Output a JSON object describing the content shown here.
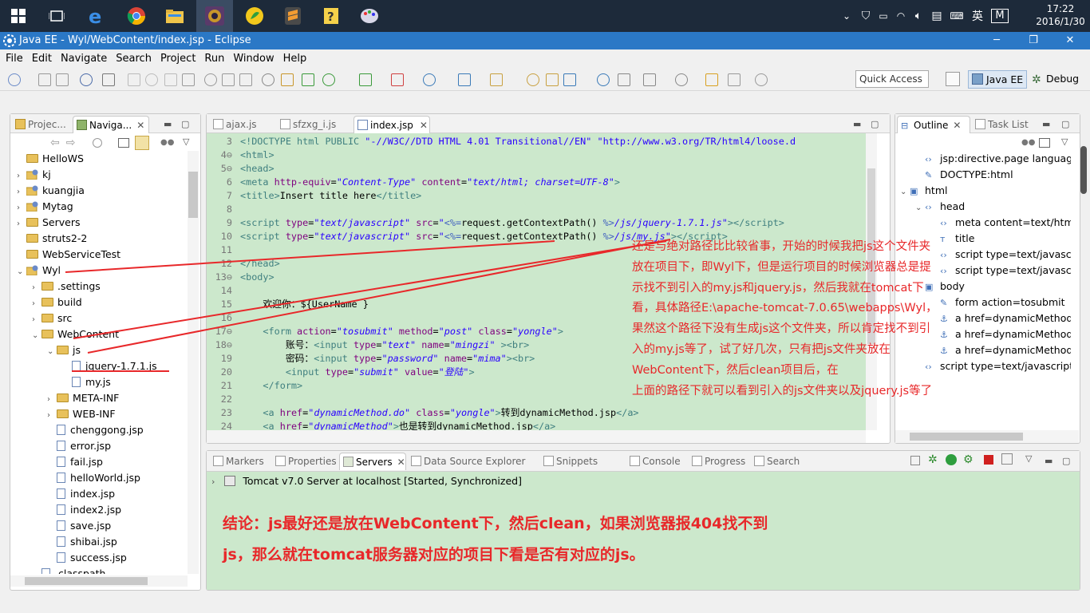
{
  "taskbar": {
    "time": "17:22",
    "date": "2016/1/30",
    "ime1": "英",
    "ime2": "M"
  },
  "window": {
    "title": "Java EE - Wyl/WebContent/index.jsp - Eclipse"
  },
  "menu": [
    "File",
    "Edit",
    "Navigate",
    "Search",
    "Project",
    "Run",
    "Window",
    "Help"
  ],
  "toolbar": {
    "quick_access": "Quick Access",
    "persp_javaee": "Java EE",
    "persp_debug": "Debug"
  },
  "left": {
    "tabs": [
      "Projec...",
      "Naviga..."
    ],
    "tree": [
      {
        "label": "HelloWS",
        "depth": 0,
        "arrow": "",
        "icon": "folder"
      },
      {
        "label": "kj",
        "depth": 0,
        "arrow": "›",
        "icon": "project"
      },
      {
        "label": "kuangjia",
        "depth": 0,
        "arrow": "›",
        "icon": "project"
      },
      {
        "label": "Mytag",
        "depth": 0,
        "arrow": "›",
        "icon": "project"
      },
      {
        "label": "Servers",
        "depth": 0,
        "arrow": "›",
        "icon": "folder"
      },
      {
        "label": "struts2-2",
        "depth": 0,
        "arrow": "",
        "icon": "folder"
      },
      {
        "label": "WebServiceTest",
        "depth": 0,
        "arrow": "",
        "icon": "folder"
      },
      {
        "label": "Wyl",
        "depth": 0,
        "arrow": "⌄",
        "icon": "project"
      },
      {
        "label": ".settings",
        "depth": 1,
        "arrow": "›",
        "icon": "folder"
      },
      {
        "label": "build",
        "depth": 1,
        "arrow": "›",
        "icon": "folder"
      },
      {
        "label": "src",
        "depth": 1,
        "arrow": "›",
        "icon": "folder"
      },
      {
        "label": "WebContent",
        "depth": 1,
        "arrow": "⌄",
        "icon": "folder"
      },
      {
        "label": "js",
        "depth": 2,
        "arrow": "⌄",
        "icon": "folder"
      },
      {
        "label": "jquery-1.7.1.js",
        "depth": 3,
        "arrow": "",
        "icon": "file"
      },
      {
        "label": "my.js",
        "depth": 3,
        "arrow": "",
        "icon": "file"
      },
      {
        "label": "META-INF",
        "depth": 2,
        "arrow": "›",
        "icon": "folder"
      },
      {
        "label": "WEB-INF",
        "depth": 2,
        "arrow": "›",
        "icon": "folder"
      },
      {
        "label": "chenggong.jsp",
        "depth": 2,
        "arrow": "",
        "icon": "file"
      },
      {
        "label": "error.jsp",
        "depth": 2,
        "arrow": "",
        "icon": "file"
      },
      {
        "label": "fail.jsp",
        "depth": 2,
        "arrow": "",
        "icon": "file"
      },
      {
        "label": "helloWorld.jsp",
        "depth": 2,
        "arrow": "",
        "icon": "file"
      },
      {
        "label": "index.jsp",
        "depth": 2,
        "arrow": "",
        "icon": "file"
      },
      {
        "label": "index2.jsp",
        "depth": 2,
        "arrow": "",
        "icon": "file"
      },
      {
        "label": "save.jsp",
        "depth": 2,
        "arrow": "",
        "icon": "file"
      },
      {
        "label": "shibai.jsp",
        "depth": 2,
        "arrow": "",
        "icon": "file"
      },
      {
        "label": "success.jsp",
        "depth": 2,
        "arrow": "",
        "icon": "file"
      },
      {
        "label": ".classpath",
        "depth": 1,
        "arrow": "",
        "icon": "file"
      }
    ]
  },
  "editor": {
    "tabs": [
      "ajax.js",
      "sfzxg_i.js",
      "index.jsp"
    ],
    "lines": [
      {
        "n": "3",
        "html": "<span class='tg'>&lt;!DOCTYPE html PUBLIC </span><span class='st' style='font-style:normal'>\"-//W3C//DTD HTML 4.01 Transitional//EN\" \"http://www.w3.org/TR/html4/loose.d</span>"
      },
      {
        "n": "4⊖",
        "html": "<span class='tg'>&lt;html&gt;</span>"
      },
      {
        "n": "5⊖",
        "html": "<span class='tg'>&lt;head&gt;</span>"
      },
      {
        "n": "6",
        "html": "<span class='tg'>&lt;meta </span><span class='at'>http-equiv</span>=<span class='st'>\"Content-Type\"</span> <span class='at'>content</span>=<span class='st'>\"text/html; charset=UTF-8\"</span><span class='tg'>&gt;</span>"
      },
      {
        "n": "7",
        "html": "<span class='tg'>&lt;title&gt;</span>Insert title here<span class='tg'>&lt;/title&gt;</span>"
      },
      {
        "n": "8",
        "html": ""
      },
      {
        "n": "9",
        "html": "<span class='tg'>&lt;script </span><span class='at'>type</span>=<span class='st'>\"text/javascript\"</span> <span class='at'>src</span>=<span class='st'>\"</span><span class='dt'>&lt;%=</span>request.getContextPath() <span class='dt'>%&gt;</span><span class='st'>/js/jquery-1.7.1.js\"</span><span class='tg'>&gt;&lt;/script&gt;</span>"
      },
      {
        "n": "10",
        "html": "<span class='tg'>&lt;script </span><span class='at'>type</span>=<span class='st'>\"text/javascript\"</span> <span class='at'>src</span>=<span class='st'>\"</span><span class='dt'>&lt;%=</span>request.getContextPath() <span class='dt'>%&gt;</span><span class='st'>/js/my.js\"</span><span class='tg'>&gt;&lt;/script&gt;</span>"
      },
      {
        "n": "11",
        "html": ""
      },
      {
        "n": "12",
        "html": "<span class='tg'>&lt;/head&gt;</span>"
      },
      {
        "n": "13⊖",
        "html": "<span class='tg'>&lt;body&gt;</span>"
      },
      {
        "n": "14",
        "html": ""
      },
      {
        "n": "15",
        "html": "    欢迎你：${UserName }"
      },
      {
        "n": "16",
        "html": ""
      },
      {
        "n": "17⊖",
        "html": "    <span class='tg'>&lt;form </span><span class='at'>action</span>=<span class='st'>\"tosubmit\"</span> <span class='at'>method</span>=<span class='st'>\"post\"</span> <span class='at'>class</span>=<span class='st'>\"yongle\"</span><span class='tg'>&gt;</span>"
      },
      {
        "n": "18⊖",
        "html": "        账号：<span class='tg'>&lt;input </span><span class='at'>type</span>=<span class='st'>\"text\"</span> <span class='at'>name</span>=<span class='st'>\"mingzi\"</span> <span class='tg'>&gt;&lt;br&gt;</span>"
      },
      {
        "n": "19",
        "html": "        密码：<span class='tg'>&lt;input </span><span class='at'>type</span>=<span class='st'>\"password\"</span> <span class='at'>name</span>=<span class='st'>\"mima\"</span><span class='tg'>&gt;&lt;br&gt;</span>"
      },
      {
        "n": "20",
        "html": "        <span class='tg'>&lt;input </span><span class='at'>type</span>=<span class='st'>\"submit\"</span> <span class='at'>value</span>=<span class='st'>\"登陆\"</span><span class='tg'>&gt;</span>"
      },
      {
        "n": "21",
        "html": "    <span class='tg'>&lt;/form&gt;</span>"
      },
      {
        "n": "22",
        "html": ""
      },
      {
        "n": "23",
        "html": "    <span class='tg'>&lt;a </span><span class='at'>href</span>=<span class='st'>\"dynamicMethod.do\"</span> <span class='at'>class</span>=<span class='st'>\"yongle\"</span><span class='tg'>&gt;</span>转到dynamicMethod.jsp<span class='tg'>&lt;/a&gt;</span>"
      },
      {
        "n": "24",
        "html": "    <span class='tg'>&lt;a </span><span class='at'>href</span>=<span class='st'>\"dynamicMethod\"</span><span class='tg'>&gt;</span>也是转到dynamicMethod.jsp<span class='tg'>&lt;/a&gt;</span>"
      }
    ]
  },
  "outline": {
    "tabs": [
      "Outline",
      "Task List"
    ],
    "rows": [
      {
        "label": "jsp:directive.page language=jav",
        "depth": 1,
        "icon": "<>",
        "arrow": ""
      },
      {
        "label": "DOCTYPE:html",
        "depth": 1,
        "icon": "doc",
        "arrow": ""
      },
      {
        "label": "html",
        "depth": 0,
        "icon": "box",
        "arrow": "⌄"
      },
      {
        "label": "head",
        "depth": 1,
        "icon": "<>",
        "arrow": "⌄"
      },
      {
        "label": "meta content=text/html; c",
        "depth": 2,
        "icon": "<>",
        "arrow": ""
      },
      {
        "label": "title",
        "depth": 2,
        "icon": "tt",
        "arrow": ""
      },
      {
        "label": "script type=text/javascrip",
        "depth": 2,
        "icon": "<>",
        "arrow": ""
      },
      {
        "label": "script type=text/javascrip",
        "depth": 2,
        "icon": "<>",
        "arrow": ""
      },
      {
        "label": "body",
        "depth": 1,
        "icon": "box",
        "arrow": ""
      },
      {
        "label": "form action=tosubmit",
        "depth": 2,
        "icon": "doc",
        "arrow": ""
      },
      {
        "label": "a href=dynamicMethod.d",
        "depth": 2,
        "icon": "anchor",
        "arrow": ""
      },
      {
        "label": "a href=dynamicMethod",
        "depth": 2,
        "icon": "anchor",
        "arrow": ""
      },
      {
        "label": "a href=dynamicMethod.a",
        "depth": 2,
        "icon": "anchor",
        "arrow": ""
      },
      {
        "label": "script type=text/javascript",
        "depth": 1,
        "icon": "<>",
        "arrow": ""
      }
    ]
  },
  "bottom": {
    "tabs": [
      "Markers",
      "Properties",
      "Servers",
      "Data Source Explorer",
      "Snippets",
      "Console",
      "Progress",
      "Search"
    ],
    "server_row": "Tomcat v7.0 Server at localhost  [Started, Synchronized]"
  },
  "annotations": {
    "note": [
      "还是与绝对路径比比较省事，开始的时候我把js这个文件夹",
      "放在项目下，即Wyl下，但是运行项目的时候浏览器总是提",
      "示找不到引入的my.js和jquery.js，然后我就在tomcat下",
      "看，具体路径E:\\apache-tomcat-7.0.65\\webapps\\Wyl，",
      "果然这个路径下没有生成js这个文件夹，所以肯定找不到引",
      "入的my.js等了，试了好几次，只有把js文件夹放在",
      "WebContent下，然后clean项目后，在",
      "上面的路径下就可以看到引入的js文件夹以及jquery.js等了"
    ],
    "conclusion": [
      "结论：js最好还是放在WebContent下，然后clean，如果浏览器报404找不到",
      "js，那么就在tomcat服务器对应的项目下看是否有对应的js。"
    ]
  },
  "colors": {
    "annotation": "#e8282a",
    "editor_bg": "#cce8cc",
    "title_bar": "#2b78c6",
    "taskbar": "#1d2a3a"
  }
}
